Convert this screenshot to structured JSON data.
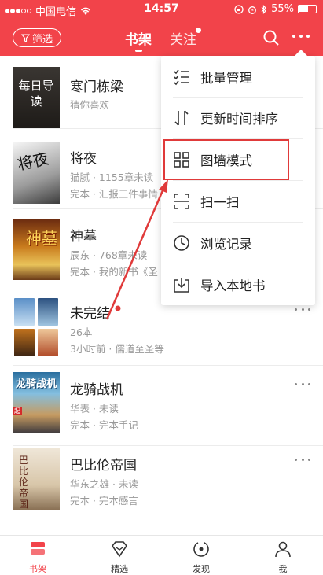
{
  "status_bar": {
    "carrier": "中国电信",
    "time": "14:57",
    "battery": "55%"
  },
  "header": {
    "filter_label": "筛选",
    "tabs": [
      {
        "label": "书架",
        "active": true
      },
      {
        "label": "关注",
        "active": false,
        "has_dot": true
      }
    ],
    "search_icon": "search-icon",
    "more_icon": "more-icon"
  },
  "books": [
    {
      "title": "寒门栋梁",
      "meta1": "猜你喜欢",
      "meta2": "",
      "cover_text": "每日导读"
    },
    {
      "title": "将夜",
      "meta1": "猫腻 · 1155章未读",
      "meta2": "完本 · 汇报三件事情",
      "cover_text": "将夜"
    },
    {
      "title": "神墓",
      "meta1": "辰东 · 768章未读",
      "meta2": "完本 · 我的新书《圣",
      "cover_text": "神墓"
    },
    {
      "title": "未完结",
      "meta1": "26本",
      "meta2": "3小时前 · 儒道至圣等"
    },
    {
      "title": "龙骑战机",
      "meta1": "华表 · 未读",
      "meta2": "完本 · 完本手记",
      "cover_text": "龙骑战机"
    },
    {
      "title": "巴比伦帝国",
      "meta1": "华东之雄 · 未读",
      "meta2": "完本 · 完本感言",
      "cover_text": "巴比伦帝国"
    }
  ],
  "menu": {
    "items": [
      {
        "label": "批量管理",
        "icon": "checklist-icon"
      },
      {
        "label": "更新时间排序",
        "icon": "sort-icon"
      },
      {
        "label": "图墙模式",
        "icon": "grid-icon",
        "highlighted": true
      },
      {
        "label": "扫一扫",
        "icon": "scan-icon"
      },
      {
        "label": "浏览记录",
        "icon": "clock-icon"
      },
      {
        "label": "导入本地书",
        "icon": "import-icon"
      }
    ]
  },
  "tabbar": {
    "items": [
      {
        "label": "书架",
        "icon": "bookshelf-icon",
        "active": true
      },
      {
        "label": "精选",
        "icon": "diamond-icon",
        "active": false
      },
      {
        "label": "发现",
        "icon": "discover-icon",
        "active": false
      },
      {
        "label": "我",
        "icon": "person-icon",
        "active": false
      }
    ]
  },
  "colors": {
    "accent": "#f2434a",
    "highlight_box": "#e03a3a"
  }
}
